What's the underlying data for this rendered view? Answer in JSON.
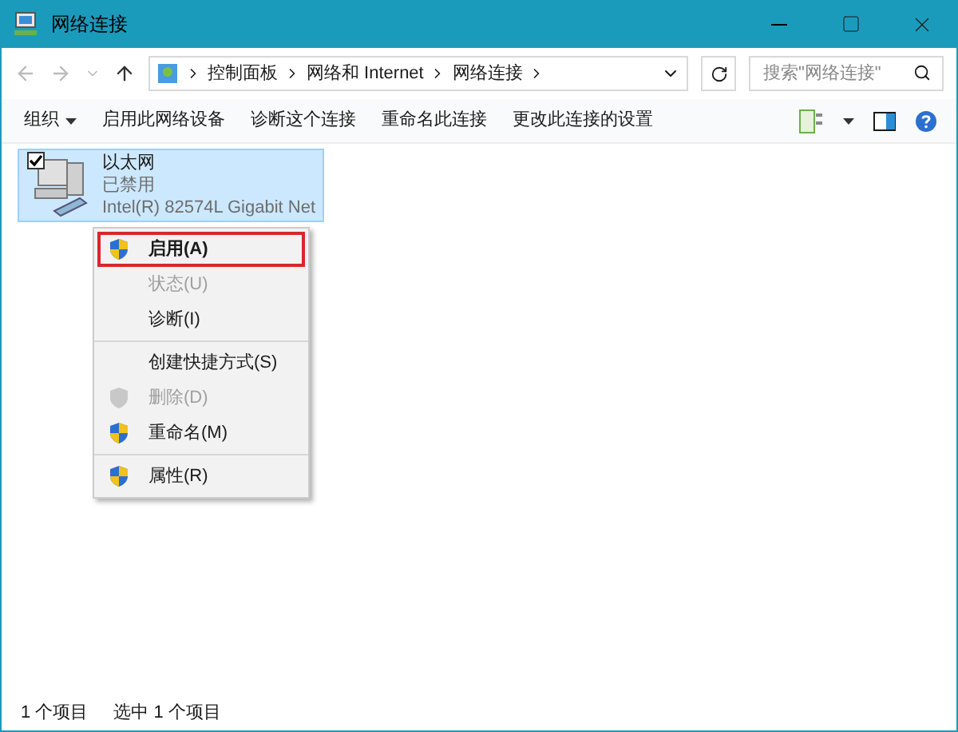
{
  "window": {
    "title": "网络连接"
  },
  "address_bar": {
    "crumbs": [
      "控制面板",
      "网络和 Internet",
      "网络连接"
    ]
  },
  "search": {
    "placeholder": "搜索\"网络连接\""
  },
  "toolbar": [
    {
      "label": "组织",
      "dropdown": true
    },
    {
      "label": "启用此网络设备",
      "dropdown": false
    },
    {
      "label": "诊断这个连接",
      "dropdown": false
    },
    {
      "label": "重命名此连接",
      "dropdown": false
    },
    {
      "label": "更改此连接的设置",
      "dropdown": false
    }
  ],
  "connection": {
    "name": "以太网",
    "status": "已禁用",
    "device": "Intel(R) 82574L Gigabit Net",
    "selected": true,
    "checked": true
  },
  "context_menu": {
    "groups": [
      [
        {
          "label": "启用(A)",
          "shield": true,
          "disabled": false,
          "highlighted": true
        },
        {
          "label": "状态(U)",
          "shield": false,
          "disabled": true,
          "highlighted": false
        },
        {
          "label": "诊断(I)",
          "shield": false,
          "disabled": false,
          "highlighted": false
        }
      ],
      [
        {
          "label": "创建快捷方式(S)",
          "shield": false,
          "disabled": false,
          "highlighted": false
        },
        {
          "label": "删除(D)",
          "shield": true,
          "disabled": true,
          "highlighted": false
        },
        {
          "label": "重命名(M)",
          "shield": true,
          "disabled": false,
          "highlighted": false
        }
      ],
      [
        {
          "label": "属性(R)",
          "shield": true,
          "disabled": false,
          "highlighted": false
        }
      ]
    ]
  },
  "status_bar": {
    "count": "1 个项目",
    "selection": "选中 1 个项目"
  }
}
